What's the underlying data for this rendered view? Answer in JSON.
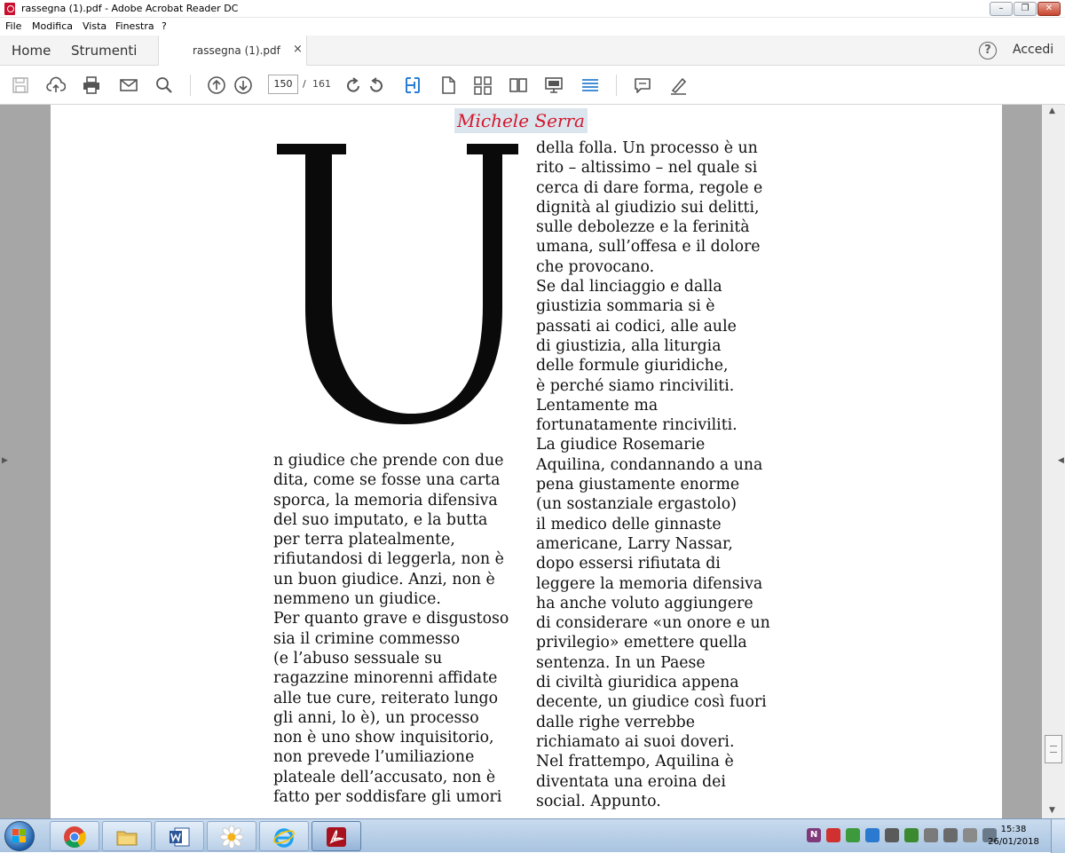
{
  "window": {
    "title": "rassegna (1).pdf - Adobe Acrobat Reader DC",
    "min_label": "–",
    "max_label": "❐",
    "close_label": "✕"
  },
  "menu": [
    "File",
    "Modifica",
    "Vista",
    "Finestra",
    "?"
  ],
  "tabs": {
    "home": "Home",
    "tools": "Strumenti",
    "document": "rassegna (1).pdf",
    "close": "×",
    "help": "?",
    "sign_in": "Accedi"
  },
  "toolbar": {
    "icons": [
      "save-icon",
      "upload-cloud-icon",
      "print-icon",
      "mail-icon",
      "search-icon",
      "page-up-icon",
      "page-down-icon",
      "rotate-clockwise-icon",
      "rotate-counterclockwise-icon",
      "select-tool-icon",
      "page-view-icon",
      "two-page-scroll-icon",
      "two-page-view-icon",
      "presentation-icon",
      "scroll-mode-icon",
      "comment-icon",
      "sign-icon"
    ],
    "current_page": "150",
    "page_sep": "/",
    "total_pages": "161"
  },
  "article": {
    "author": "Michele Serra",
    "dropcap": "U",
    "left_column": [
      "n giudice che prende con due",
      "dita, come se fosse una carta",
      "sporca, la memoria difensiva",
      "del suo imputato, e la butta",
      "per terra platealmente,",
      "rifiutandosi di leggerla, non è",
      "un buon giudice. Anzi, non è",
      "nemmeno un giudice.",
      "Per quanto grave e disgustoso",
      "sia il crimine commesso",
      "(e l’abuso sessuale su",
      "ragazzine minorenni affidate",
      "alle tue cure, reiterato lungo",
      "gli anni, lo è), un processo",
      "non è uno show inquisitorio,",
      "non prevede l’umiliazione",
      "plateale dell’accusato, non è",
      "fatto per soddisfare gli umori"
    ],
    "right_column": [
      "della folla. Un processo è un",
      "rito – altissimo – nel quale si",
      "cerca di dare forma, regole e",
      "dignità al giudizio sui delitti,",
      "sulle debolezze e la ferinità",
      "umana, sull’offesa e il dolore",
      "che provocano.",
      "Se dal linciaggio e dalla",
      "giustizia sommaria si è",
      "passati ai codici, alle aule",
      "di giustizia, alla liturgia",
      "delle formule giuridiche,",
      "è perché siamo rinciviliti.",
      "Lentamente ma",
      "fortunatamente rinciviliti.",
      "La giudice Rosemarie",
      "Aquilina, condannando a una",
      "pena giustamente enorme",
      "(un sostanziale ergastolo)",
      "il medico delle ginnaste",
      "americane, Larry Nassar,",
      "dopo essersi rifiutata di",
      "leggere la memoria difensiva",
      "ha anche voluto aggiungere",
      "di considerare «un onore e un",
      "privilegio» emettere quella",
      "sentenza. In un Paese",
      "di civiltà giuridica appena",
      "decente, un giudice così fuori",
      "dalle righe verrebbe",
      "richiamato ai suoi doveri.",
      "Nel frattempo, Aquilina è",
      "diventata una eroina dei",
      "social. Appunto."
    ]
  },
  "taskbar": {
    "apps": [
      "chrome-icon",
      "explorer-folder-icon",
      "word-icon",
      "daisy-app-icon",
      "internet-explorer-icon",
      "acrobat-icon"
    ],
    "tray_letters": [
      "N",
      "",
      "",
      "",
      "",
      "",
      "",
      "",
      "",
      ""
    ],
    "time": "15:38",
    "date": "26/01/2018"
  }
}
